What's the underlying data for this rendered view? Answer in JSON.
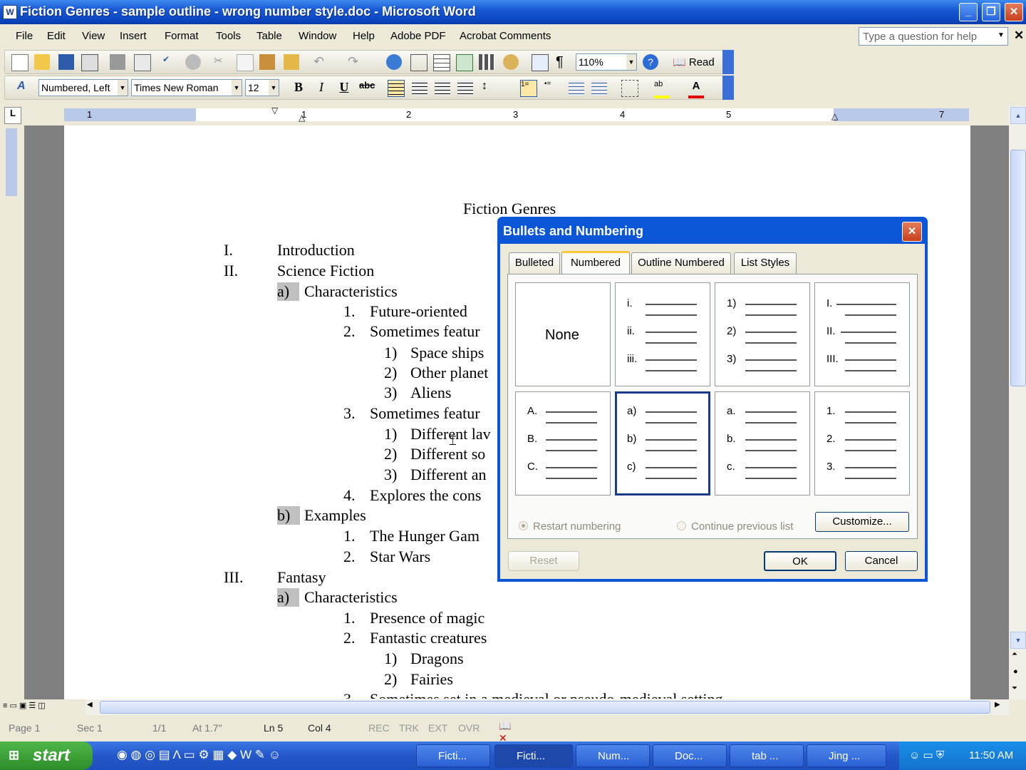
{
  "window": {
    "title": "Fiction Genres - sample outline - wrong number style.doc - Microsoft Word"
  },
  "menus": [
    "File",
    "Edit",
    "View",
    "Insert",
    "Format",
    "Tools",
    "Table",
    "Window",
    "Help",
    "Adobe PDF",
    "Acrobat Comments"
  ],
  "help": {
    "placeholder": "Type a question for help"
  },
  "toolbar": {
    "zoom": "110%",
    "read": "Read",
    "style": "Numbered, Left",
    "font": "Times New Roman",
    "size": "12"
  },
  "ruler": {
    "numbers": [
      "1",
      "1",
      "2",
      "3",
      "4",
      "5",
      "7"
    ]
  },
  "document": {
    "title": "Fiction Genres",
    "lines": [
      {
        "num": "I.",
        "text": "Introduction"
      },
      {
        "num": "II.",
        "text": "Science Fiction"
      },
      {
        "num": "a)",
        "text": "Characteristics"
      },
      {
        "num": "1.",
        "text": "Future-oriented"
      },
      {
        "num": "2.",
        "text": "Sometimes featur"
      },
      {
        "num": "1)",
        "text": "Space ships"
      },
      {
        "num": "2)",
        "text": "Other planet"
      },
      {
        "num": "3)",
        "text": "Aliens"
      },
      {
        "num": "3.",
        "text": "Sometimes featur"
      },
      {
        "num": "1)",
        "text": "Different lav"
      },
      {
        "num": "2)",
        "text": "Different so"
      },
      {
        "num": "3)",
        "text": "Different an"
      },
      {
        "num": "4.",
        "text": "Explores the cons"
      },
      {
        "num": "b)",
        "text": "Examples"
      },
      {
        "num": "1.",
        "text": "The Hunger Gam"
      },
      {
        "num": "2.",
        "text": "Star Wars"
      },
      {
        "num": "III.",
        "text": "Fantasy"
      },
      {
        "num": "a)",
        "text": "Characteristics"
      },
      {
        "num": "1.",
        "text": "Presence of magic"
      },
      {
        "num": "2.",
        "text": "Fantastic creatures"
      },
      {
        "num": "1)",
        "text": "Dragons"
      },
      {
        "num": "2)",
        "text": "Fairies"
      },
      {
        "num": "3.",
        "text": "Sometimes set in a medieval or pseudo-medieval setting"
      }
    ]
  },
  "dialog": {
    "title": "Bullets and Numbering",
    "tabs": [
      "Bulleted",
      "Numbered",
      "Outline Numbered",
      "List Styles"
    ],
    "active_tab": "Numbered",
    "none_label": "None",
    "styles": [
      [
        "i.",
        "ii.",
        "iii."
      ],
      [
        "1)",
        "2)",
        "3)"
      ],
      [
        "I.",
        "II.",
        "III."
      ],
      [
        "A.",
        "B.",
        "C."
      ],
      [
        "a)",
        "b)",
        "c)"
      ],
      [
        "a.",
        "b.",
        "c."
      ],
      [
        "1.",
        "2.",
        "3."
      ]
    ],
    "selected_style": "a) b) c)",
    "restart": "Restart numbering",
    "continue": "Continue previous list",
    "customize": "Customize...",
    "reset": "Reset",
    "ok": "OK",
    "cancel": "Cancel"
  },
  "status": {
    "page": "Page 1",
    "sec": "Sec 1",
    "pages": "1/1",
    "at": "At 1.7\"",
    "ln": "Ln 5",
    "col": "Col 4",
    "rec": "REC",
    "trk": "TRK",
    "ext": "EXT",
    "ovr": "OVR"
  },
  "taskbar": {
    "start": "start",
    "tasks": [
      "Ficti...",
      "Ficti...",
      "Num...",
      "Doc...",
      "tab ...",
      "Jing ..."
    ],
    "clock": "11:50 AM"
  }
}
